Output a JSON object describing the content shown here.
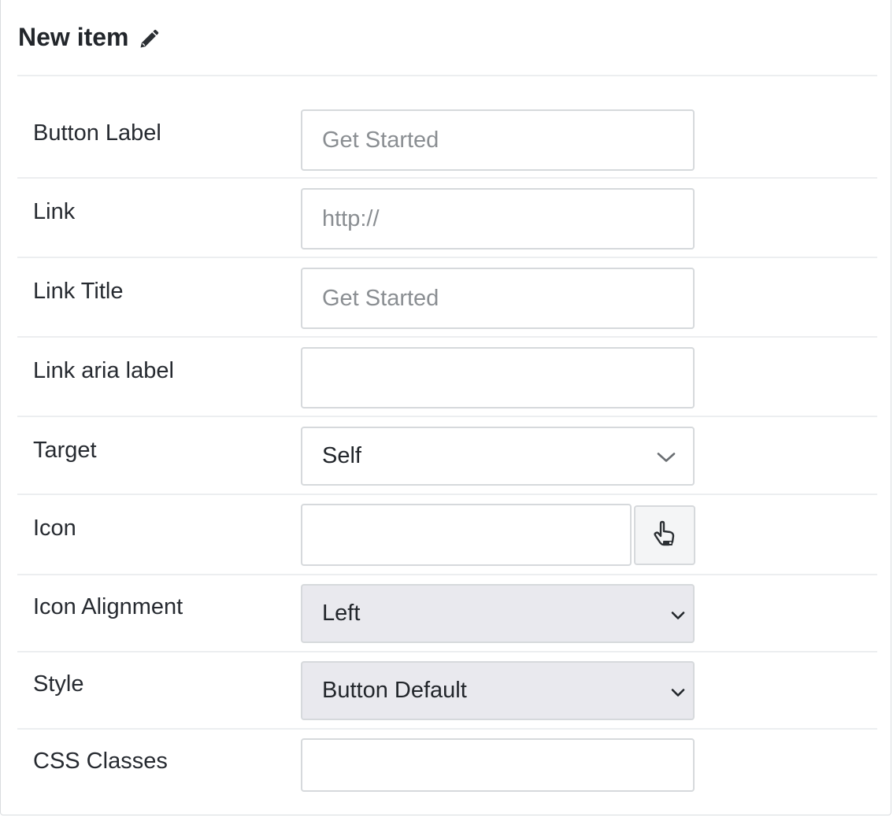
{
  "header": {
    "title": "New item"
  },
  "fields": {
    "button_label": {
      "label": "Button Label",
      "placeholder": "Get Started"
    },
    "link": {
      "label": "Link",
      "placeholder": "http://"
    },
    "link_title": {
      "label": "Link Title",
      "placeholder": "Get Started"
    },
    "link_aria_label": {
      "label": "Link aria label",
      "value": ""
    },
    "target": {
      "label": "Target",
      "selected": "Self"
    },
    "icon": {
      "label": "Icon",
      "value": ""
    },
    "icon_alignment": {
      "label": "Icon Alignment",
      "selected": "Left"
    },
    "style": {
      "label": "Style",
      "selected": "Button Default"
    },
    "css_classes": {
      "label": "CSS Classes",
      "value": ""
    }
  },
  "icons": {
    "title_edit": "pencil-icon",
    "target_dropdown": "chevron-down-icon",
    "icon_picker": "pointer-hand-icon",
    "select_arrow": "chevron-down-icon"
  },
  "colors": {
    "border": "#d6d9dc",
    "divider": "#eceef0",
    "select_gray": "#e9e9ee",
    "text": "#262a30",
    "placeholder": "#8a8e92"
  }
}
